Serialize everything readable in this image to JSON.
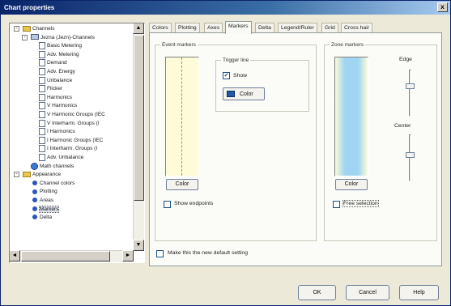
{
  "window": {
    "title": "Chart properties",
    "close_glyph": "x"
  },
  "tree": {
    "items": [
      {
        "label": "Channels",
        "indent": 0,
        "icon": "folder-icon",
        "expander": "-"
      },
      {
        "label": "Jezna (Jezn)-Channels",
        "indent": 1,
        "icon": "device-icon",
        "expander": "-"
      },
      {
        "label": "Basic Metering",
        "indent": 2,
        "icon": "doc-icon"
      },
      {
        "label": "Adv. Metering",
        "indent": 2,
        "icon": "doc-icon"
      },
      {
        "label": "Demand",
        "indent": 2,
        "icon": "doc-icon"
      },
      {
        "label": "Adv. Energy",
        "indent": 2,
        "icon": "doc-icon"
      },
      {
        "label": "Unbalance",
        "indent": 2,
        "icon": "doc-icon"
      },
      {
        "label": "Flicker",
        "indent": 2,
        "icon": "doc-icon"
      },
      {
        "label": "Harmonics",
        "indent": 2,
        "icon": "doc-icon"
      },
      {
        "label": "V Harmonics",
        "indent": 2,
        "icon": "doc-icon"
      },
      {
        "label": "V Harmonic Groups (IEC",
        "indent": 2,
        "icon": "doc-icon"
      },
      {
        "label": "V Interharm. Groups (I",
        "indent": 2,
        "icon": "doc-icon"
      },
      {
        "label": "I Harmonics",
        "indent": 2,
        "icon": "doc-icon"
      },
      {
        "label": "I Harmonic Groups (IEC",
        "indent": 2,
        "icon": "doc-icon"
      },
      {
        "label": "I Interharm. Groups (I",
        "indent": 2,
        "icon": "doc-icon"
      },
      {
        "label": "Adv. Unbalance",
        "indent": 2,
        "icon": "doc-icon"
      },
      {
        "label": "Math channels",
        "indent": 1,
        "icon": "meter-icon"
      },
      {
        "label": "Appearance",
        "indent": 0,
        "icon": "folder-icon",
        "expander": "-"
      },
      {
        "label": "Channel colors",
        "indent": 1,
        "icon": "bullet-icon"
      },
      {
        "label": "Plotting",
        "indent": 1,
        "icon": "bullet-icon"
      },
      {
        "label": "Areas",
        "indent": 1,
        "icon": "bullet-icon"
      },
      {
        "label": "Markers",
        "indent": 1,
        "icon": "bullet-icon",
        "selected": true
      },
      {
        "label": "Delta",
        "indent": 1,
        "icon": "bullet-icon"
      }
    ],
    "scroll_up": "▲",
    "scroll_down": "▼",
    "scroll_left": "◄",
    "scroll_right": "►"
  },
  "tabs": [
    {
      "label": "Colors",
      "active": false
    },
    {
      "label": "Plotting",
      "active": false
    },
    {
      "label": "Axes",
      "active": false
    },
    {
      "label": "Markers",
      "active": true
    },
    {
      "label": "Delta",
      "active": false
    },
    {
      "label": "Legend/Ruler",
      "active": false
    },
    {
      "label": "Grid",
      "active": false
    },
    {
      "label": "Cross hair",
      "active": false
    }
  ],
  "event_markers": {
    "title": "Event markers",
    "trigger_line": {
      "title": "Trigger line",
      "show_label": "Show",
      "show_checked": true,
      "color_button": "Color",
      "color": "#1e5aa8"
    },
    "color_button": "Color",
    "show_endpoints_label": "Show endpoints",
    "show_endpoints_checked": false,
    "preview_colors": {
      "fill": "#fdfbd8",
      "line": "#9aa040"
    }
  },
  "zone_markers": {
    "title": "Zone markers",
    "color_button": "Color",
    "free_selection_label": "Free selection",
    "free_selection_checked": false,
    "edge_label": "Edge",
    "center_label": "Center",
    "edge_level": 0.35,
    "center_level": 0.45,
    "preview_colors": {
      "edge": "#fdfbd8",
      "center": "#9fd4f3"
    }
  },
  "default_setting_label": "Make this the new default setting",
  "default_setting_checked": false,
  "buttons": {
    "ok": "OK",
    "cancel": "Cancel",
    "help": "Help"
  }
}
